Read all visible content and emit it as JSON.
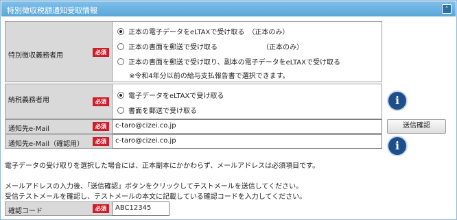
{
  "panel": {
    "title": "特別徴収税額通知受取情報",
    "collapse_glyph": "⌃"
  },
  "required_label": "必須",
  "section_obligor": {
    "label": "特別徴収義務者用",
    "options": [
      {
        "text": "正本の電子データをeLTAXで受け取る　（正本のみ）",
        "checked": true
      },
      {
        "text": "正本の書面を郵送で受け取る　　　　　　　（正本のみ）",
        "checked": false
      },
      {
        "text": "正本の書面を郵送で受け取り、副本の電子データをeLTAXで受け取る",
        "checked": false
      }
    ],
    "note": "※令和4年分以前の給与支払報告書で選択できます。"
  },
  "section_taxpayer": {
    "label": "納税義務者用",
    "options": [
      {
        "text": "電子データをeLTAXで受け取る",
        "checked": true
      },
      {
        "text": "書面を郵送で受け取る",
        "checked": false
      }
    ]
  },
  "email": {
    "label": "通知先e-Mail",
    "value": "c-taro@cizei.co.jp"
  },
  "email_confirm": {
    "label": "通知先e-Mail（確認用）",
    "value": "c-taro@cizei.co.jp"
  },
  "send_confirm_button": "送信確認",
  "info_icon_glyph": "i",
  "messages": {
    "line1": "電子データの受け取りを選択した場合には、正本副本にかかわらず、メールアドレスは必須項目です。",
    "line2": "メールアドレスの入力後、「送信確認」ボタンをクリックしてテストメールを送信してください。",
    "line3": "受信テストメールを確認し、テストメールの本文に記載している確認コードを入力してください。"
  },
  "confirm_code": {
    "label": "確認コード",
    "value": "ABC12345"
  },
  "colors": {
    "title_bar": "#5aa6d8",
    "required_badge": "#cc1f2b",
    "info_icon": "#1d4f8c",
    "label_bg": "#d9d9d9"
  }
}
